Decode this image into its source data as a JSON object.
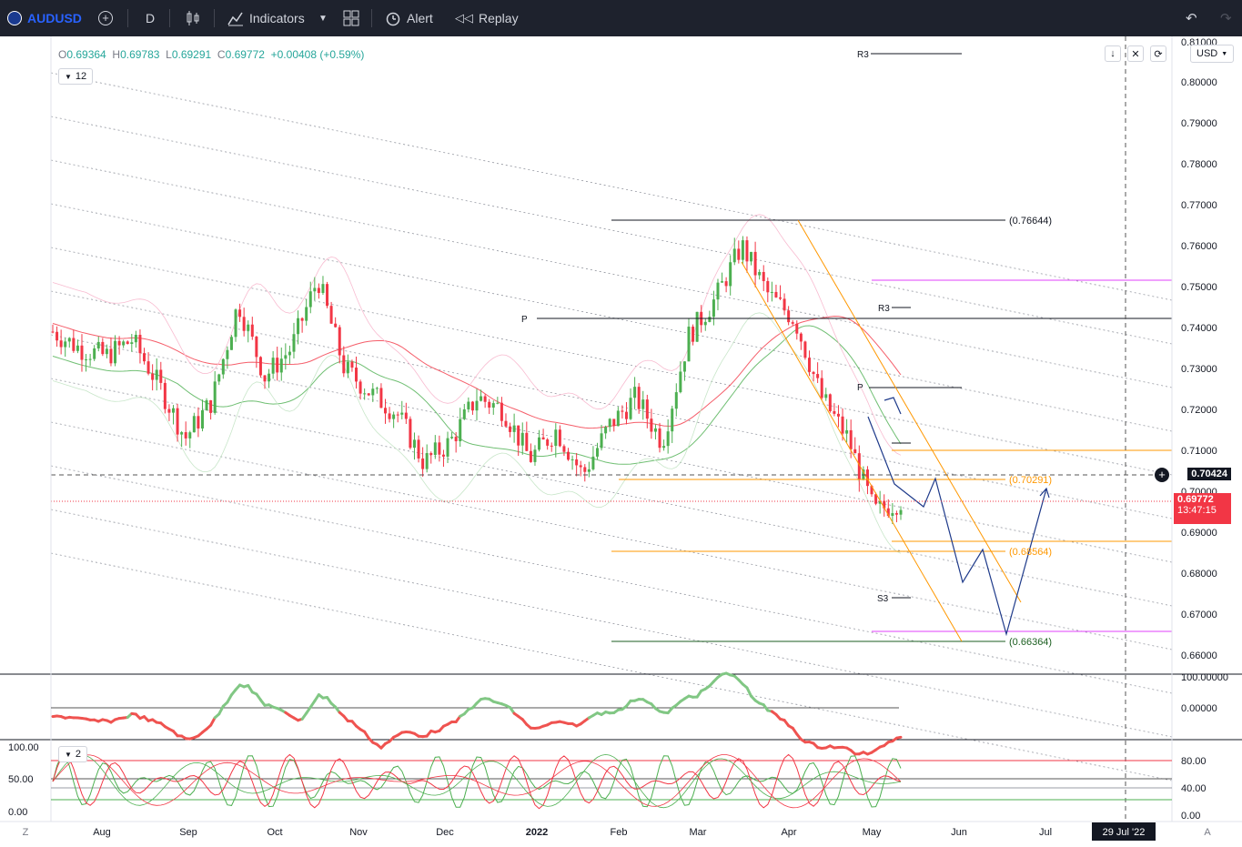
{
  "toolbar": {
    "symbol": "AUDUSD",
    "interval": "D",
    "indicators_label": "Indicators",
    "alert_label": "Alert",
    "replay_label": "Replay"
  },
  "legend": {
    "o_label": "O",
    "o_value": "0.69364",
    "h_label": "H",
    "h_value": "0.69783",
    "l_label": "L",
    "l_value": "0.69291",
    "c_label": "C",
    "c_value": "0.69772",
    "change": "+0.00408 (+0.59%)",
    "indicator_count": "12",
    "lower_pane_count": "2"
  },
  "price_axis": {
    "currency": "USD",
    "top_label": "0.81000",
    "ticks": [
      "0.80000",
      "0.79000",
      "0.78000",
      "0.77000",
      "0.76000",
      "0.75000",
      "0.74000",
      "0.73000",
      "0.72000",
      "0.71000",
      "0.70000",
      "0.69000",
      "0.68000",
      "0.67000",
      "0.66000"
    ],
    "crosshair_price": "0.70424",
    "last_price": "0.69772",
    "countdown": "13:47:15"
  },
  "osc_axis": {
    "ticks": [
      "100.00000",
      "0.00000"
    ]
  },
  "stoch_axis": {
    "left_ticks": [
      "100.00",
      "50.00",
      "0.00"
    ],
    "right_ticks": [
      "80.00",
      "40.00",
      "0.00"
    ]
  },
  "time_axis": {
    "labels": [
      "Aug",
      "Sep",
      "Oct",
      "Nov",
      "Dec",
      "2022",
      "Feb",
      "Mar",
      "Apr",
      "May",
      "Jun",
      "Jul"
    ],
    "crosshair_date": "29 Jul '22",
    "left_btn": "Z",
    "right_btn": "A"
  },
  "annotations": {
    "level_high": "(0.76644)",
    "level_mid": "(0.70291)",
    "level_low": "(0.68564)",
    "level_bottom": "(0.66364)",
    "r3_top": "R3",
    "r3": "R3",
    "pivot_left": "P",
    "pivot_right": "P",
    "s3": "S3"
  },
  "colors": {
    "bull": "#4caf50",
    "bear": "#f23645",
    "accent": "#2962ff",
    "fib_orange": "#ff9800",
    "magenta": "#e040fb",
    "background": "#ffffff",
    "toolbar_bg": "#1e222d"
  },
  "chart_data": {
    "type": "candlestick",
    "symbol": "AUDUSD",
    "interval": "D",
    "x": [
      "2021-07",
      "2021-08",
      "2021-09",
      "2021-10",
      "2021-11",
      "2021-12",
      "2022-01",
      "2022-02",
      "2022-03",
      "2022-04",
      "2022-05"
    ],
    "close_path": [
      0.739,
      0.735,
      0.733,
      0.737,
      0.726,
      0.713,
      0.722,
      0.746,
      0.728,
      0.735,
      0.752,
      0.73,
      0.724,
      0.719,
      0.707,
      0.712,
      0.723,
      0.72,
      0.708,
      0.715,
      0.704,
      0.716,
      0.723,
      0.712,
      0.738,
      0.747,
      0.76,
      0.748,
      0.742,
      0.723,
      0.713,
      0.695,
      0.6977
    ],
    "ylim": [
      0.655,
      0.81
    ],
    "levels": [
      0.76644,
      0.70291,
      0.68564,
      0.66364
    ],
    "crosshair_price": 0.70424,
    "last": 0.69772
  }
}
